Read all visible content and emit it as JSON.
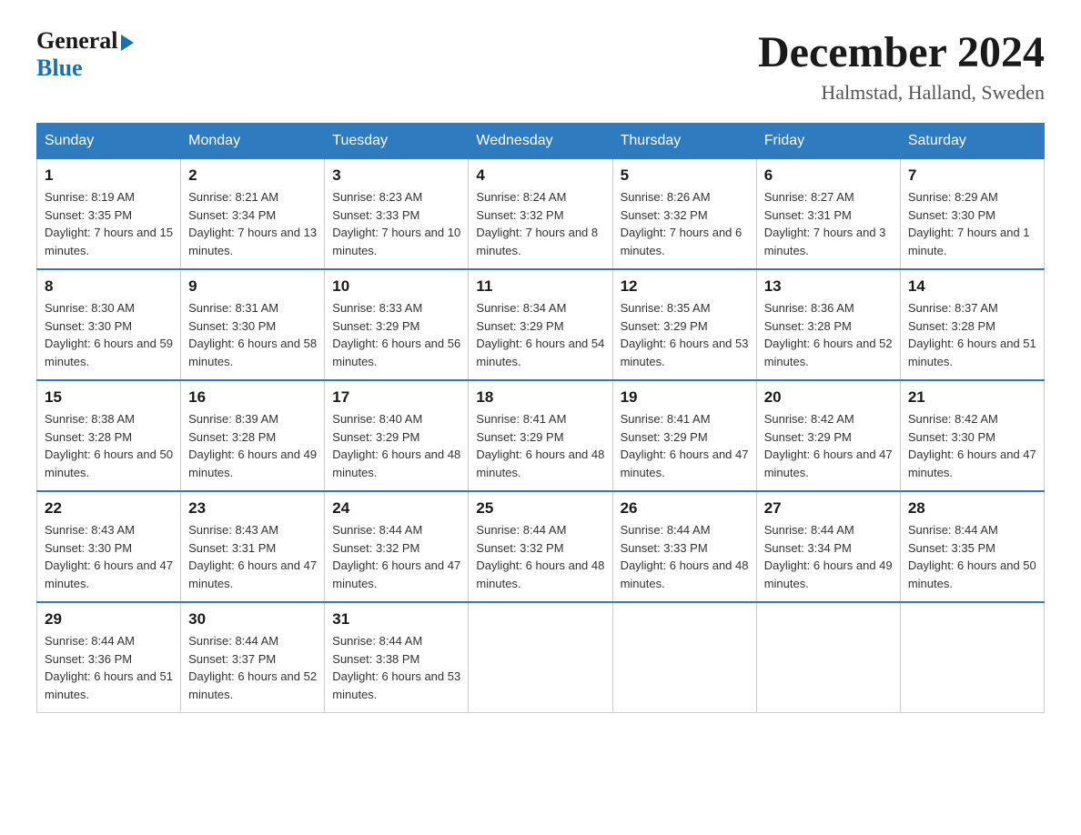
{
  "header": {
    "logo_general": "General",
    "logo_blue": "Blue",
    "month_title": "December 2024",
    "location": "Halmstad, Halland, Sweden"
  },
  "days_of_week": [
    "Sunday",
    "Monday",
    "Tuesday",
    "Wednesday",
    "Thursday",
    "Friday",
    "Saturday"
  ],
  "weeks": [
    [
      {
        "day": "1",
        "sunrise": "8:19 AM",
        "sunset": "3:35 PM",
        "daylight": "7 hours and 15 minutes."
      },
      {
        "day": "2",
        "sunrise": "8:21 AM",
        "sunset": "3:34 PM",
        "daylight": "7 hours and 13 minutes."
      },
      {
        "day": "3",
        "sunrise": "8:23 AM",
        "sunset": "3:33 PM",
        "daylight": "7 hours and 10 minutes."
      },
      {
        "day": "4",
        "sunrise": "8:24 AM",
        "sunset": "3:32 PM",
        "daylight": "7 hours and 8 minutes."
      },
      {
        "day": "5",
        "sunrise": "8:26 AM",
        "sunset": "3:32 PM",
        "daylight": "7 hours and 6 minutes."
      },
      {
        "day": "6",
        "sunrise": "8:27 AM",
        "sunset": "3:31 PM",
        "daylight": "7 hours and 3 minutes."
      },
      {
        "day": "7",
        "sunrise": "8:29 AM",
        "sunset": "3:30 PM",
        "daylight": "7 hours and 1 minute."
      }
    ],
    [
      {
        "day": "8",
        "sunrise": "8:30 AM",
        "sunset": "3:30 PM",
        "daylight": "6 hours and 59 minutes."
      },
      {
        "day": "9",
        "sunrise": "8:31 AM",
        "sunset": "3:30 PM",
        "daylight": "6 hours and 58 minutes."
      },
      {
        "day": "10",
        "sunrise": "8:33 AM",
        "sunset": "3:29 PM",
        "daylight": "6 hours and 56 minutes."
      },
      {
        "day": "11",
        "sunrise": "8:34 AM",
        "sunset": "3:29 PM",
        "daylight": "6 hours and 54 minutes."
      },
      {
        "day": "12",
        "sunrise": "8:35 AM",
        "sunset": "3:29 PM",
        "daylight": "6 hours and 53 minutes."
      },
      {
        "day": "13",
        "sunrise": "8:36 AM",
        "sunset": "3:28 PM",
        "daylight": "6 hours and 52 minutes."
      },
      {
        "day": "14",
        "sunrise": "8:37 AM",
        "sunset": "3:28 PM",
        "daylight": "6 hours and 51 minutes."
      }
    ],
    [
      {
        "day": "15",
        "sunrise": "8:38 AM",
        "sunset": "3:28 PM",
        "daylight": "6 hours and 50 minutes."
      },
      {
        "day": "16",
        "sunrise": "8:39 AM",
        "sunset": "3:28 PM",
        "daylight": "6 hours and 49 minutes."
      },
      {
        "day": "17",
        "sunrise": "8:40 AM",
        "sunset": "3:29 PM",
        "daylight": "6 hours and 48 minutes."
      },
      {
        "day": "18",
        "sunrise": "8:41 AM",
        "sunset": "3:29 PM",
        "daylight": "6 hours and 48 minutes."
      },
      {
        "day": "19",
        "sunrise": "8:41 AM",
        "sunset": "3:29 PM",
        "daylight": "6 hours and 47 minutes."
      },
      {
        "day": "20",
        "sunrise": "8:42 AM",
        "sunset": "3:29 PM",
        "daylight": "6 hours and 47 minutes."
      },
      {
        "day": "21",
        "sunrise": "8:42 AM",
        "sunset": "3:30 PM",
        "daylight": "6 hours and 47 minutes."
      }
    ],
    [
      {
        "day": "22",
        "sunrise": "8:43 AM",
        "sunset": "3:30 PM",
        "daylight": "6 hours and 47 minutes."
      },
      {
        "day": "23",
        "sunrise": "8:43 AM",
        "sunset": "3:31 PM",
        "daylight": "6 hours and 47 minutes."
      },
      {
        "day": "24",
        "sunrise": "8:44 AM",
        "sunset": "3:32 PM",
        "daylight": "6 hours and 47 minutes."
      },
      {
        "day": "25",
        "sunrise": "8:44 AM",
        "sunset": "3:32 PM",
        "daylight": "6 hours and 48 minutes."
      },
      {
        "day": "26",
        "sunrise": "8:44 AM",
        "sunset": "3:33 PM",
        "daylight": "6 hours and 48 minutes."
      },
      {
        "day": "27",
        "sunrise": "8:44 AM",
        "sunset": "3:34 PM",
        "daylight": "6 hours and 49 minutes."
      },
      {
        "day": "28",
        "sunrise": "8:44 AM",
        "sunset": "3:35 PM",
        "daylight": "6 hours and 50 minutes."
      }
    ],
    [
      {
        "day": "29",
        "sunrise": "8:44 AM",
        "sunset": "3:36 PM",
        "daylight": "6 hours and 51 minutes."
      },
      {
        "day": "30",
        "sunrise": "8:44 AM",
        "sunset": "3:37 PM",
        "daylight": "6 hours and 52 minutes."
      },
      {
        "day": "31",
        "sunrise": "8:44 AM",
        "sunset": "3:38 PM",
        "daylight": "6 hours and 53 minutes."
      },
      null,
      null,
      null,
      null
    ]
  ],
  "labels": {
    "sunrise_prefix": "Sunrise: ",
    "sunset_prefix": "Sunset: ",
    "daylight_prefix": "Daylight: "
  }
}
